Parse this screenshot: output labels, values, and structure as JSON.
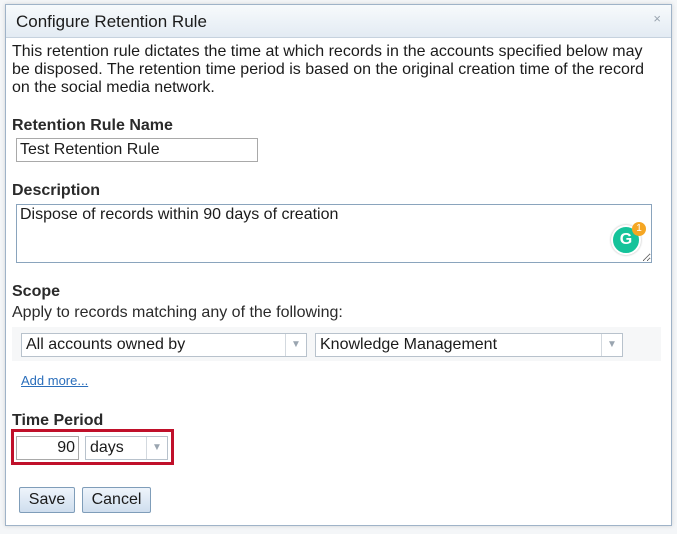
{
  "dialog": {
    "title": "Configure Retention Rule",
    "close_glyph": "×",
    "intro": "This retention rule dictates the time at which records in the accounts specified below may be disposed. The retention time period is based on the original creation time of the record on the social media network."
  },
  "rule_name": {
    "label": "Retention Rule Name",
    "value": "Test Retention Rule"
  },
  "description": {
    "label": "Description",
    "value": "Dispose of records within 90 days of creation",
    "grammarly_letter": "G",
    "grammarly_count": "1"
  },
  "scope": {
    "label": "Scope",
    "subtitle": "Apply to records matching any of the following:",
    "criteria_select": "All accounts owned by",
    "owner_select": "Knowledge Management",
    "add_more": "Add more..."
  },
  "time_period": {
    "label": "Time Period",
    "amount": "90",
    "unit": "days"
  },
  "buttons": {
    "save": "Save",
    "cancel": "Cancel"
  },
  "colors": {
    "highlight": "#c0102a",
    "link": "#2a6ebb",
    "grammarly": "#15c39a"
  }
}
